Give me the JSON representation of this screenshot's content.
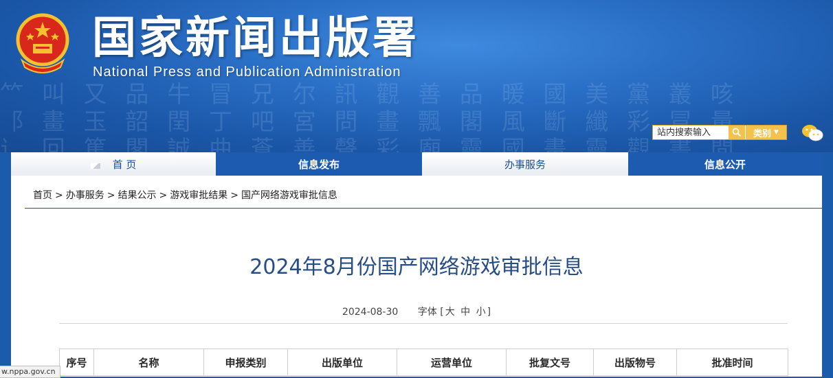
{
  "header": {
    "title": "国家新闻出版署",
    "subtitle": "National  Press and Publication Administration",
    "search_placeholder": "站内搜索输入",
    "category_label": "类别"
  },
  "nav": {
    "items": [
      {
        "label": "首 页"
      },
      {
        "label": "信息发布"
      },
      {
        "label": "办事服务"
      },
      {
        "label": "信息公开"
      }
    ]
  },
  "breadcrumb": {
    "items": [
      "首页",
      "办事服务",
      "结果公示",
      "游戏审批结果",
      "国产网络游戏审批信息"
    ],
    "separator": ">"
  },
  "article": {
    "title": "2024年8月份国产网络游戏审批信息",
    "date": "2024-08-30",
    "font_label": "字体",
    "font_open": "[",
    "font_large": "大",
    "font_medium": "中",
    "font_small": "小",
    "font_close": "]"
  },
  "table": {
    "headers": [
      "序号",
      "名称",
      "申报类别",
      "出版单位",
      "运营单位",
      "批复文号",
      "出版物号",
      "批准时间"
    ]
  },
  "status_bar": {
    "url": "w.nppa.gov.cn"
  },
  "colors": {
    "banner": "#1b57a8",
    "nav_dark": "#1d5bb0",
    "title_text": "#274d86",
    "search_accent": "#f3c14c"
  }
}
